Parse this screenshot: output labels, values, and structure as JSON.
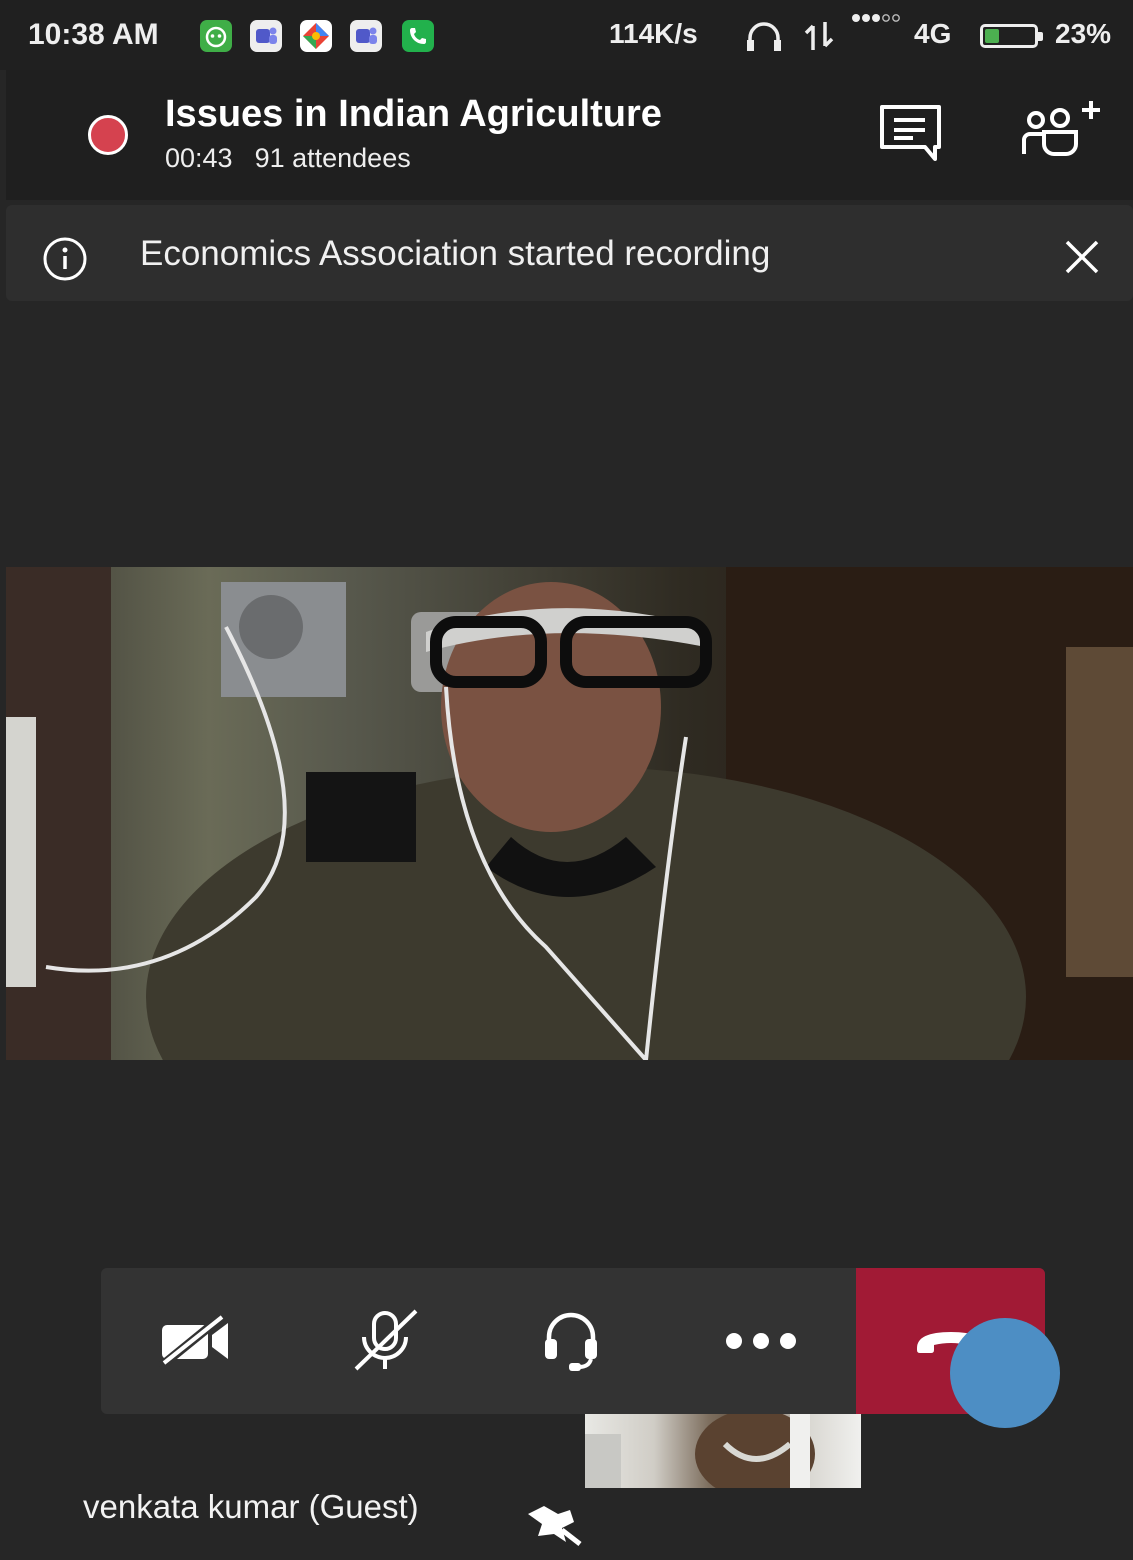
{
  "status_bar": {
    "time": "10:38 AM",
    "speed": "114K/s",
    "network": "4G",
    "battery": "23%",
    "battery_level": 0.23,
    "notification_icons": [
      "alien-app-icon",
      "teams-icon",
      "maps-icon",
      "teams-icon",
      "phone-call-icon"
    ],
    "colors": {
      "bar_bg": "#202020"
    }
  },
  "meeting": {
    "title": "Issues in Indian Agriculture",
    "duration": "00:43",
    "attendees": "91 attendees",
    "recording_color": "#d5424f"
  },
  "banner": {
    "message": "Economics Association started recording"
  },
  "controls": {
    "items": [
      "camera-off-icon",
      "mic-off-icon",
      "headset-icon",
      "more-icon",
      "hang-up-icon"
    ],
    "hangup_color": "#a11a35"
  },
  "participant": {
    "name": "venkata kumar (Guest)"
  },
  "colors": {
    "background": "#262626",
    "header_bg": "#1f1f1f",
    "banner_bg": "#2e2e2e",
    "controls_bg": "#333333",
    "fab": "#4d8ec4"
  }
}
